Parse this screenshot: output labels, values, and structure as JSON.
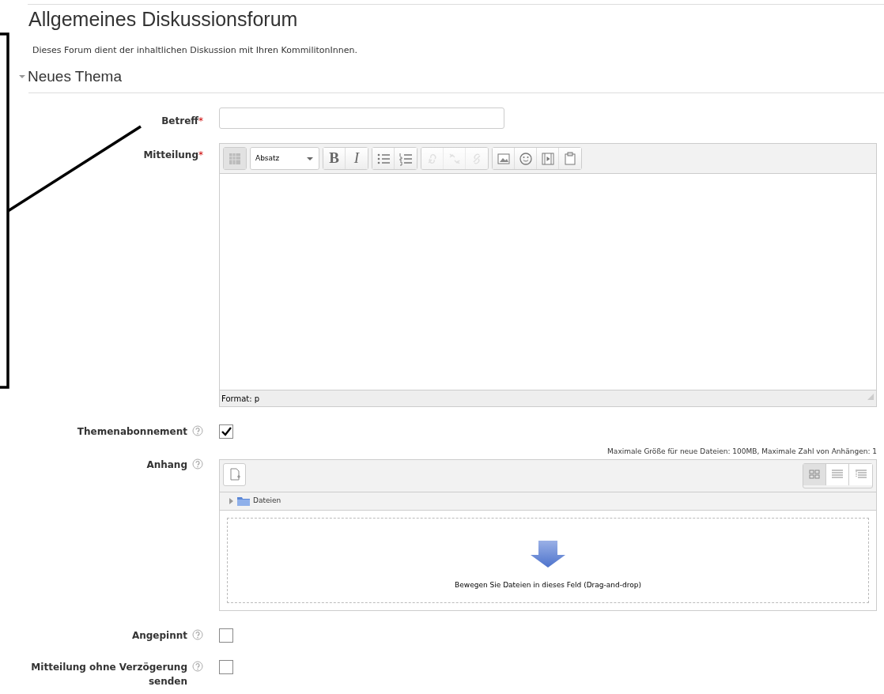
{
  "forum": {
    "title": "Allgemeines Diskussionsforum",
    "description": "Dieses Forum dient der inhaltlichen Diskussion mit Ihren KommilitonInnen."
  },
  "section": {
    "title": "Neues Thema",
    "expanded": true
  },
  "fields": [
    {
      "kind": "text",
      "label": "Betreff",
      "required_mark": "*",
      "help": false
    },
    {
      "kind": "editor",
      "label": "Mitteilung",
      "required_mark": "*",
      "help": false,
      "toolbar": [
        [
          {
            "kind": "toggle",
            "disabled": false
          }
        ],
        [
          {
            "kind": "dropdown",
            "label": "Absatz",
            "disabled": false
          }
        ],
        [
          {
            "kind": "bold",
            "label": "B",
            "disabled": false
          },
          {
            "kind": "italic",
            "label": "I",
            "disabled": false
          }
        ],
        [
          {
            "kind": "bullets",
            "disabled": false
          },
          {
            "kind": "numbers",
            "disabled": false
          }
        ],
        [
          {
            "kind": "link",
            "disabled": true
          },
          {
            "kind": "unlink",
            "disabled": true
          },
          {
            "kind": "nolink",
            "disabled": true
          }
        ],
        [
          {
            "kind": "image",
            "disabled": false
          },
          {
            "kind": "emoticon",
            "disabled": false
          },
          {
            "kind": "media",
            "disabled": false
          },
          {
            "kind": "paste",
            "disabled": false
          }
        ]
      ],
      "status": "Format: p"
    },
    {
      "kind": "checkbox",
      "label": "Themenabonnement",
      "help": true,
      "checked": true
    },
    {
      "kind": "filepicker",
      "label": "Anhang",
      "help": true,
      "limits": "Maximale Größe für neue Dateien: 100MB, Maximale Zahl von Anhängen: 1",
      "views": [
        {
          "kind": "icons",
          "selected": true
        },
        {
          "kind": "list",
          "selected": false
        },
        {
          "kind": "tree",
          "selected": false
        }
      ],
      "folder": {
        "label": "Dateien",
        "expanded": false
      },
      "drop_hint": "Bewegen Sie Dateien in dieses Feld (Drag-and-drop)"
    },
    {
      "kind": "checkbox",
      "label": "Angepinnt",
      "help": true,
      "checked": false
    },
    {
      "kind": "checkbox",
      "label": "Mitteilung ohne Verzögerung senden",
      "help": true,
      "checked": false
    }
  ],
  "annotation": {
    "kind": "bracket"
  }
}
